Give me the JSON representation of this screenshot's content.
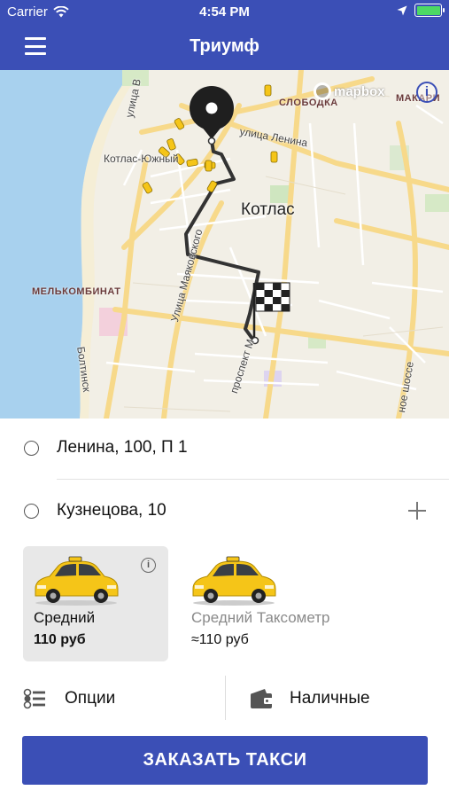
{
  "status_bar": {
    "carrier": "Carrier",
    "time": "4:54 PM",
    "battery_level": 1.0
  },
  "header": {
    "title": "Триумф"
  },
  "map": {
    "attribution": "mapbox",
    "info_icon": "info-icon",
    "labels": {
      "district_sloboda": "СЛОБОДКА",
      "district_makari": "МАКАРИ",
      "district_melkombinat": "МЕЛЬКОМБИНАТ",
      "city": "Котлас",
      "station": "Котлас-Южный",
      "street_lenina": "улица Ленина",
      "street_v": "улица В",
      "street_mayakovskogo": "Улица Маяковского",
      "street_prospekt": "проспект М",
      "street_bolt": "Болтинск",
      "street_shosse": "ное шоссе"
    },
    "start_marker": "pin-icon",
    "finish_marker": "checkered-flag-icon"
  },
  "route": {
    "from": "Ленина, 100, П 1",
    "to": "Кузнецова, 10"
  },
  "tariffs": [
    {
      "name": "Средний",
      "price": "110 руб",
      "selected": true
    },
    {
      "name": "Средний Таксометр",
      "price": "≈110 руб",
      "selected": false
    }
  ],
  "options": {
    "options_label": "Опции",
    "payment_label": "Наличные"
  },
  "order_button": {
    "label": "ЗАКАЗАТЬ ТАКСИ"
  },
  "colors": {
    "primary": "#3b4fb6",
    "taxi_yellow": "#f5c518",
    "water": "#a8d1ee",
    "route": "#333333"
  }
}
